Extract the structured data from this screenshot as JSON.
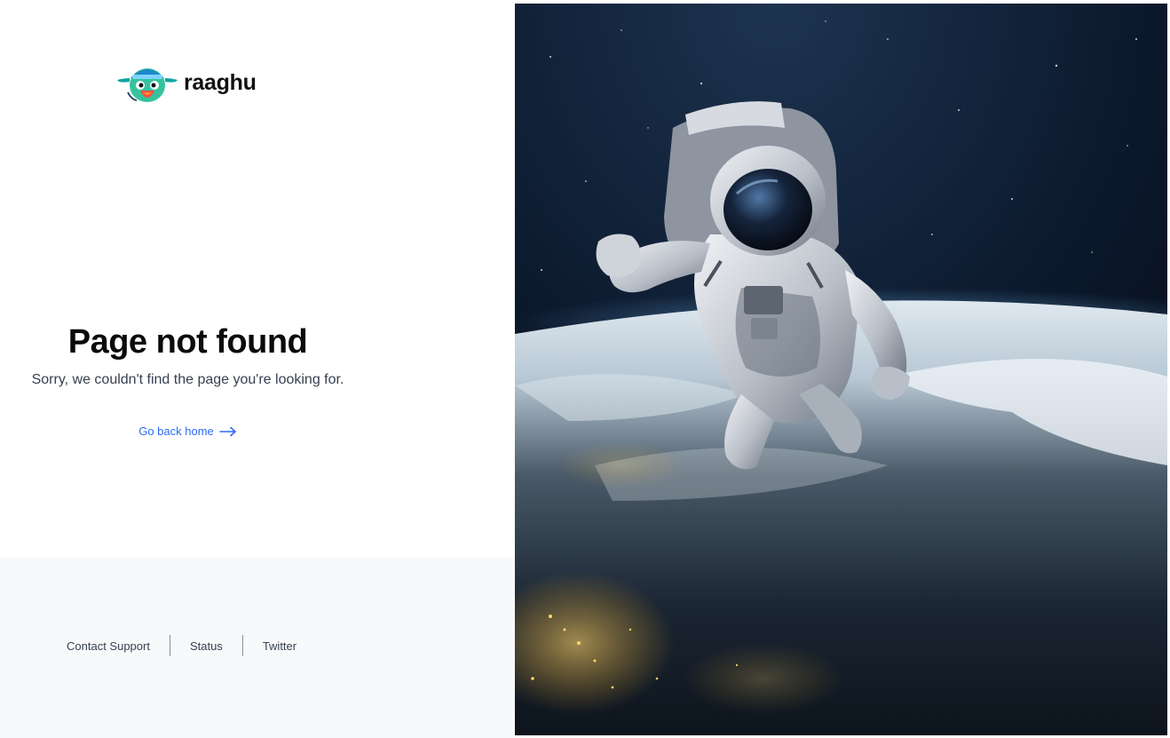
{
  "brand": {
    "name": "raaghu",
    "logo_icon": "parrot-mascot-icon"
  },
  "error": {
    "title": "Page not found",
    "message": "Sorry, we couldn't find the page you're looking for.",
    "home_link": "Go back home",
    "home_icon": "arrow-right-icon"
  },
  "footer": {
    "links": [
      "Contact Support",
      "Status",
      "Twitter"
    ]
  },
  "hero": {
    "image": "astronaut-floating-above-earth"
  },
  "colors": {
    "link": "#2f6df5",
    "title": "#0b0b0b",
    "text": "#374151",
    "footer_bg": "#f8f9fb"
  }
}
